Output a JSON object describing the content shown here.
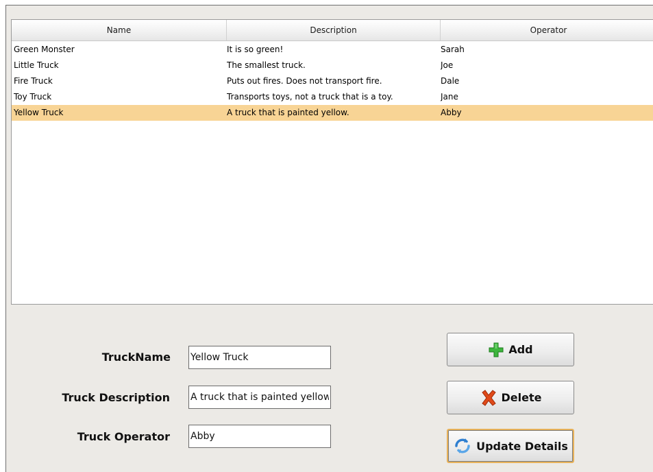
{
  "table": {
    "columns": [
      "Name",
      "Description",
      "Operator"
    ],
    "rows": [
      {
        "name": "Green Monster",
        "description": "It is so green!",
        "operator": "Sarah"
      },
      {
        "name": "Little Truck",
        "description": "The smallest truck.",
        "operator": "Joe"
      },
      {
        "name": "Fire Truck",
        "description": "Puts out fires. Does not transport fire.",
        "operator": "Dale"
      },
      {
        "name": "Toy Truck",
        "description": "Transports toys, not a truck that is a toy.",
        "operator": "Jane"
      },
      {
        "name": "Yellow Truck",
        "description": "A truck that is painted yellow.",
        "operator": "Abby"
      }
    ],
    "selected_row": "Yellow Truck"
  },
  "form": {
    "name_label": "TruckName",
    "name_value": "Yellow Truck",
    "description_label": "Truck Description",
    "description_value": "A truck that is painted yellow.",
    "operator_label": "Truck Operator",
    "operator_value": "Abby"
  },
  "buttons": {
    "add_label": "Add",
    "add_icon": "plus-icon",
    "delete_label": "Delete",
    "delete_icon": "x-icon",
    "update_label": "Update Details",
    "update_icon": "refresh-icon"
  },
  "colors": {
    "selection": "#f8d495",
    "add_icon": "#3db53d",
    "delete_icon": "#e04a1a",
    "update_icon": "#2f7fd0"
  }
}
